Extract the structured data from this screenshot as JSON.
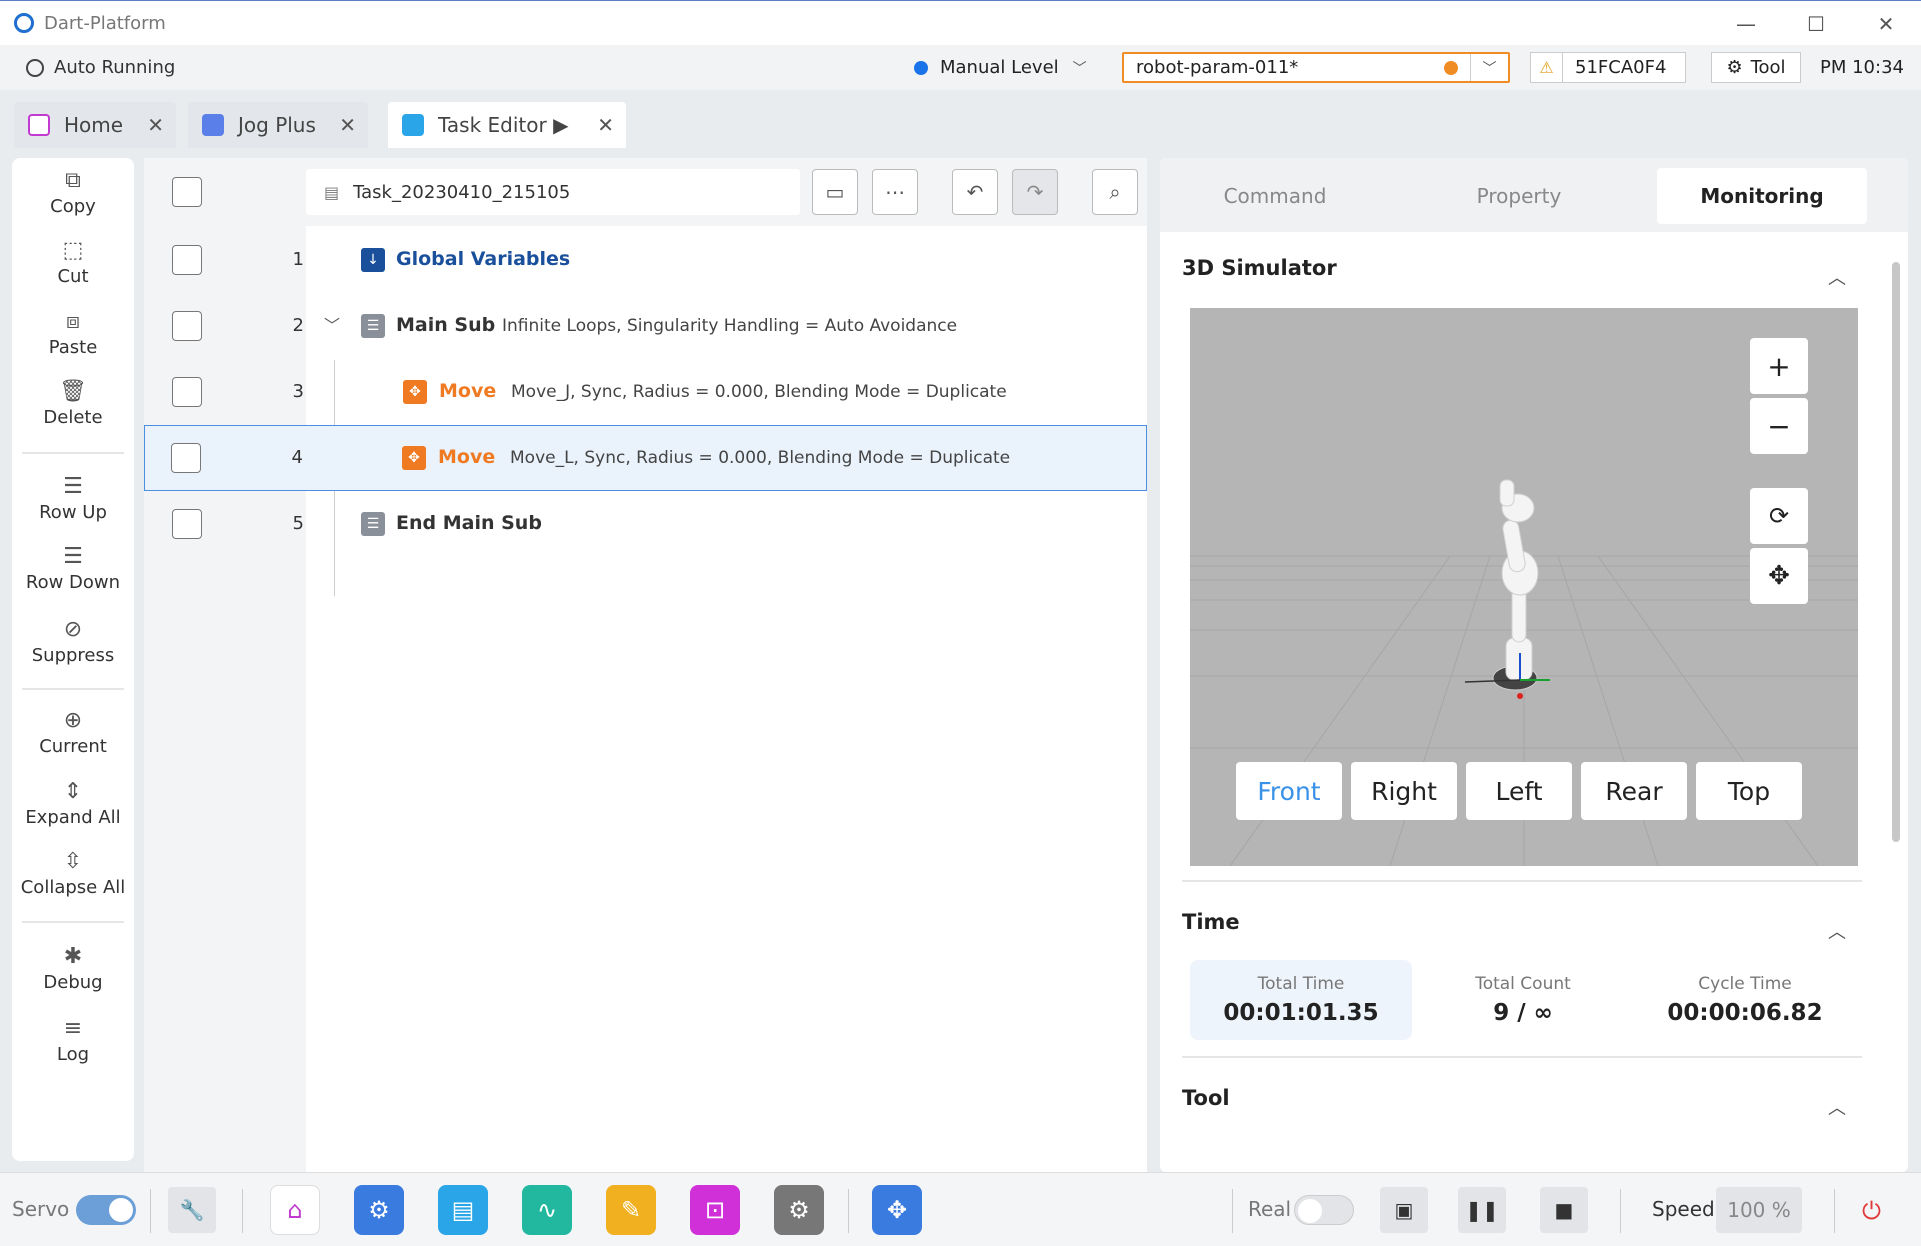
{
  "window": {
    "title": "Dart-Platform",
    "minimize": "—",
    "maximize": "☐",
    "close": "✕"
  },
  "status": {
    "mode": "Auto Running",
    "level": "Manual Level",
    "robot_param": "robot-param-011*",
    "serial": "51FCA0F4",
    "tool_label": "Tool",
    "clock": "PM 10:34"
  },
  "tabs": [
    {
      "label": "Home"
    },
    {
      "label": "Jog Plus"
    },
    {
      "label": "Task Editor ▶"
    }
  ],
  "left_tools": [
    {
      "label": "Copy",
      "icon": "⧉"
    },
    {
      "label": "Cut",
      "icon": "⬚"
    },
    {
      "label": "Paste",
      "icon": "⧈"
    },
    {
      "label": "Delete",
      "icon": "🗑"
    },
    {
      "label": "Row Up",
      "icon": "☰"
    },
    {
      "label": "Row Down",
      "icon": "☰"
    },
    {
      "label": "Suppress",
      "icon": "⊘"
    },
    {
      "label": "Current",
      "icon": "⊕"
    },
    {
      "label": "Expand All",
      "icon": "⇕"
    },
    {
      "label": "Collapse All",
      "icon": "⇳"
    },
    {
      "label": "Debug",
      "icon": "✱"
    },
    {
      "label": "Log",
      "icon": "≡"
    }
  ],
  "editor": {
    "filename": "Task_20230410_215105",
    "rows": [
      {
        "num": "1",
        "name": "Global Variables",
        "desc": ""
      },
      {
        "num": "2",
        "name": "Main Sub",
        "desc": "Infinite Loops, Singularity Handling = Auto Avoidance"
      },
      {
        "num": "3",
        "name": "Move",
        "desc": "Move_J, Sync, Radius = 0.000, Blending Mode = Duplicate"
      },
      {
        "num": "4",
        "name": "Move",
        "desc": "Move_L, Sync, Radius = 0.000, Blending Mode = Duplicate"
      },
      {
        "num": "5",
        "name": "End Main Sub",
        "desc": ""
      }
    ]
  },
  "right_panel": {
    "tabs": [
      "Command",
      "Property",
      "Monitoring"
    ],
    "sim_title": "3D Simulator",
    "zoom_in": "+",
    "zoom_out": "−",
    "views": [
      "Front",
      "Right",
      "Left",
      "Rear",
      "Top"
    ],
    "time_title": "Time",
    "stats": [
      {
        "label": "Total Time",
        "value": "00:01:01.35"
      },
      {
        "label": "Total Count",
        "value": "9 / ∞"
      },
      {
        "label": "Cycle Time",
        "value": "00:00:06.82"
      }
    ],
    "tool_title": "Tool"
  },
  "bottom": {
    "servo": "Servo",
    "real": "Real",
    "speed_label": "Speed",
    "speed_value": "100 %"
  },
  "colors": {
    "accent": "#1a73e8",
    "move_orange": "#f07a22",
    "global_blue": "#1a4f9c",
    "warning_orange": "#f08c24"
  }
}
